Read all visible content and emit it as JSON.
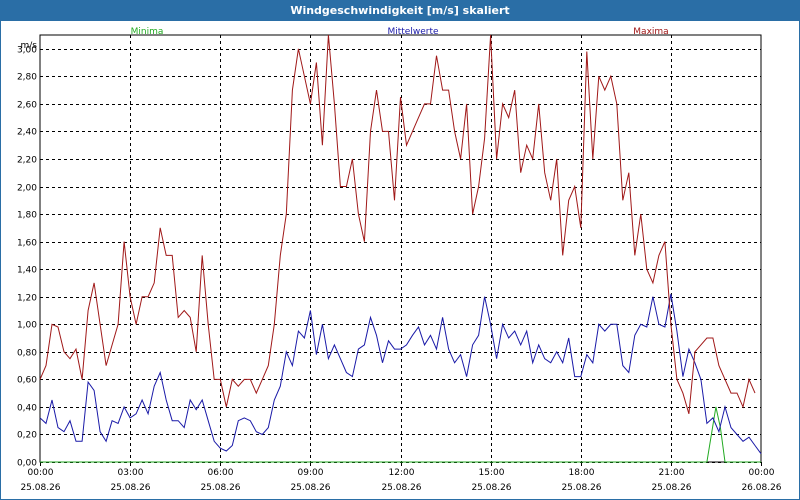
{
  "window": {
    "title": "Windgeschwindigkeit [m/s] skaliert"
  },
  "colors": {
    "min": "#22aa22",
    "avg": "#1a1aa8",
    "max": "#a01818",
    "grid": "#000000",
    "titlebar": "#2a6ea6"
  },
  "chart_data": {
    "type": "line",
    "title": "Windgeschwindigkeit [m/s] skaliert",
    "unit_label": "m/s",
    "ylim": [
      0,
      3.1
    ],
    "yticks": [
      "0,00",
      "0,20",
      "0,40",
      "0,60",
      "0,80",
      "1,00",
      "1,20",
      "1,40",
      "1,60",
      "1,80",
      "2,00",
      "2,20",
      "2,40",
      "2,60",
      "2,80",
      "3,00"
    ],
    "xlim_hours": [
      0,
      24
    ],
    "xticks": [
      {
        "time": "00:00",
        "date": "25.08.26"
      },
      {
        "time": "03:00",
        "date": "25.08.26"
      },
      {
        "time": "06:00",
        "date": "25.08.26"
      },
      {
        "time": "09:00",
        "date": "25.08.26"
      },
      {
        "time": "12:00",
        "date": "25.08.26"
      },
      {
        "time": "15:00",
        "date": "25.08.26"
      },
      {
        "time": "18:00",
        "date": "25.08.26"
      },
      {
        "time": "21:00",
        "date": "25.08.26"
      },
      {
        "time": "00:00",
        "date": "26.08.26"
      }
    ],
    "grid": true,
    "legend_position": "top",
    "series": [
      {
        "name": "Minima",
        "color": "#22aa22",
        "points": [
          [
            0,
            0
          ],
          [
            22.2,
            0
          ],
          [
            22.35,
            0.2
          ],
          [
            22.5,
            0.4
          ],
          [
            22.65,
            0.25
          ],
          [
            22.8,
            0
          ],
          [
            24,
            0
          ]
        ]
      },
      {
        "name": "Mittelwerte",
        "color": "#1a1aa8",
        "points": [
          [
            0,
            0.32
          ],
          [
            0.2,
            0.28
          ],
          [
            0.4,
            0.45
          ],
          [
            0.6,
            0.25
          ],
          [
            0.8,
            0.22
          ],
          [
            1.0,
            0.3
          ],
          [
            1.2,
            0.15
          ],
          [
            1.4,
            0.15
          ],
          [
            1.6,
            0.58
          ],
          [
            1.8,
            0.52
          ],
          [
            2.0,
            0.22
          ],
          [
            2.2,
            0.15
          ],
          [
            2.4,
            0.3
          ],
          [
            2.6,
            0.28
          ],
          [
            2.8,
            0.4
          ],
          [
            3.0,
            0.32
          ],
          [
            3.2,
            0.35
          ],
          [
            3.4,
            0.45
          ],
          [
            3.6,
            0.35
          ],
          [
            3.8,
            0.55
          ],
          [
            4.0,
            0.65
          ],
          [
            4.2,
            0.45
          ],
          [
            4.4,
            0.3
          ],
          [
            4.6,
            0.3
          ],
          [
            4.8,
            0.25
          ],
          [
            5.0,
            0.45
          ],
          [
            5.2,
            0.38
          ],
          [
            5.4,
            0.45
          ],
          [
            5.6,
            0.3
          ],
          [
            5.8,
            0.15
          ],
          [
            6.0,
            0.1
          ],
          [
            6.2,
            0.08
          ],
          [
            6.4,
            0.12
          ],
          [
            6.6,
            0.3
          ],
          [
            6.8,
            0.32
          ],
          [
            7.0,
            0.3
          ],
          [
            7.2,
            0.22
          ],
          [
            7.4,
            0.2
          ],
          [
            7.6,
            0.25
          ],
          [
            7.8,
            0.45
          ],
          [
            8.0,
            0.55
          ],
          [
            8.2,
            0.8
          ],
          [
            8.4,
            0.7
          ],
          [
            8.6,
            0.95
          ],
          [
            8.8,
            0.9
          ],
          [
            9.0,
            1.1
          ],
          [
            9.2,
            0.78
          ],
          [
            9.4,
            1.0
          ],
          [
            9.6,
            0.75
          ],
          [
            9.8,
            0.85
          ],
          [
            10.0,
            0.75
          ],
          [
            10.2,
            0.65
          ],
          [
            10.4,
            0.62
          ],
          [
            10.6,
            0.82
          ],
          [
            10.8,
            0.85
          ],
          [
            11.0,
            1.05
          ],
          [
            11.2,
            0.92
          ],
          [
            11.4,
            0.72
          ],
          [
            11.6,
            0.88
          ],
          [
            11.8,
            0.82
          ],
          [
            12.0,
            0.82
          ],
          [
            12.2,
            0.85
          ],
          [
            12.4,
            0.92
          ],
          [
            12.6,
            0.98
          ],
          [
            12.8,
            0.85
          ],
          [
            13.0,
            0.92
          ],
          [
            13.2,
            0.82
          ],
          [
            13.4,
            1.05
          ],
          [
            13.6,
            0.82
          ],
          [
            13.8,
            0.72
          ],
          [
            14.0,
            0.78
          ],
          [
            14.2,
            0.62
          ],
          [
            14.4,
            0.85
          ],
          [
            14.6,
            0.92
          ],
          [
            14.8,
            1.2
          ],
          [
            15.0,
            1.0
          ],
          [
            15.2,
            0.75
          ],
          [
            15.4,
            1.0
          ],
          [
            15.6,
            0.9
          ],
          [
            15.8,
            0.95
          ],
          [
            16.0,
            0.85
          ],
          [
            16.2,
            0.95
          ],
          [
            16.4,
            0.72
          ],
          [
            16.6,
            0.85
          ],
          [
            16.8,
            0.75
          ],
          [
            17.0,
            0.72
          ],
          [
            17.2,
            0.8
          ],
          [
            17.4,
            0.72
          ],
          [
            17.6,
            0.9
          ],
          [
            17.8,
            0.62
          ],
          [
            18.0,
            0.62
          ],
          [
            18.2,
            0.78
          ],
          [
            18.4,
            0.72
          ],
          [
            18.6,
            1.0
          ],
          [
            18.8,
            0.95
          ],
          [
            19.0,
            1.0
          ],
          [
            19.2,
            1.0
          ],
          [
            19.4,
            0.7
          ],
          [
            19.6,
            0.65
          ],
          [
            19.8,
            0.92
          ],
          [
            20.0,
            1.0
          ],
          [
            20.2,
            0.98
          ],
          [
            20.4,
            1.2
          ],
          [
            20.6,
            1.0
          ],
          [
            20.8,
            0.98
          ],
          [
            21.0,
            1.22
          ],
          [
            21.2,
            0.95
          ],
          [
            21.4,
            0.62
          ],
          [
            21.6,
            0.82
          ],
          [
            21.8,
            0.72
          ],
          [
            22.0,
            0.6
          ],
          [
            22.2,
            0.28
          ],
          [
            22.4,
            0.32
          ],
          [
            22.6,
            0.22
          ],
          [
            22.8,
            0.4
          ],
          [
            23.0,
            0.25
          ],
          [
            23.2,
            0.2
          ],
          [
            23.4,
            0.15
          ],
          [
            23.6,
            0.18
          ],
          [
            23.8,
            0.12
          ],
          [
            24.0,
            0.06
          ]
        ]
      },
      {
        "name": "Maxima",
        "color": "#a01818",
        "points": [
          [
            0,
            0.6
          ],
          [
            0.2,
            0.7
          ],
          [
            0.4,
            1.0
          ],
          [
            0.6,
            0.98
          ],
          [
            0.8,
            0.8
          ],
          [
            1.0,
            0.75
          ],
          [
            1.2,
            0.82
          ],
          [
            1.4,
            0.6
          ],
          [
            1.6,
            1.1
          ],
          [
            1.8,
            1.3
          ],
          [
            2.0,
            1.0
          ],
          [
            2.2,
            0.7
          ],
          [
            2.4,
            0.85
          ],
          [
            2.6,
            1.0
          ],
          [
            2.8,
            1.6
          ],
          [
            3.0,
            1.2
          ],
          [
            3.2,
            1.0
          ],
          [
            3.4,
            1.2
          ],
          [
            3.6,
            1.2
          ],
          [
            3.8,
            1.3
          ],
          [
            4.0,
            1.7
          ],
          [
            4.2,
            1.5
          ],
          [
            4.4,
            1.5
          ],
          [
            4.6,
            1.05
          ],
          [
            4.8,
            1.1
          ],
          [
            5.0,
            1.05
          ],
          [
            5.2,
            0.8
          ],
          [
            5.4,
            1.5
          ],
          [
            5.6,
            1.0
          ],
          [
            5.8,
            0.6
          ],
          [
            6.0,
            0.6
          ],
          [
            6.2,
            0.4
          ],
          [
            6.4,
            0.6
          ],
          [
            6.6,
            0.55
          ],
          [
            6.8,
            0.6
          ],
          [
            7.0,
            0.6
          ],
          [
            7.2,
            0.5
          ],
          [
            7.4,
            0.6
          ],
          [
            7.6,
            0.7
          ],
          [
            7.8,
            1.0
          ],
          [
            8.0,
            1.5
          ],
          [
            8.2,
            1.8
          ],
          [
            8.4,
            2.7
          ],
          [
            8.6,
            3.0
          ],
          [
            8.8,
            2.8
          ],
          [
            9.0,
            2.6
          ],
          [
            9.2,
            2.9
          ],
          [
            9.4,
            2.3
          ],
          [
            9.6,
            3.1
          ],
          [
            9.8,
            2.6
          ],
          [
            10.0,
            2.0
          ],
          [
            10.2,
            2.0
          ],
          [
            10.4,
            2.2
          ],
          [
            10.6,
            1.8
          ],
          [
            10.8,
            1.6
          ],
          [
            11.0,
            2.4
          ],
          [
            11.2,
            2.7
          ],
          [
            11.4,
            2.4
          ],
          [
            11.6,
            2.4
          ],
          [
            11.8,
            1.9
          ],
          [
            12.0,
            2.65
          ],
          [
            12.2,
            2.3
          ],
          [
            12.4,
            2.4
          ],
          [
            12.6,
            2.5
          ],
          [
            12.8,
            2.6
          ],
          [
            13.0,
            2.6
          ],
          [
            13.2,
            2.95
          ],
          [
            13.4,
            2.7
          ],
          [
            13.6,
            2.7
          ],
          [
            13.8,
            2.4
          ],
          [
            14.0,
            2.2
          ],
          [
            14.2,
            2.6
          ],
          [
            14.4,
            1.8
          ],
          [
            14.6,
            2.0
          ],
          [
            14.8,
            2.35
          ],
          [
            15.0,
            3.1
          ],
          [
            15.2,
            2.2
          ],
          [
            15.4,
            2.6
          ],
          [
            15.6,
            2.5
          ],
          [
            15.8,
            2.7
          ],
          [
            16.0,
            2.1
          ],
          [
            16.2,
            2.3
          ],
          [
            16.4,
            2.2
          ],
          [
            16.6,
            2.6
          ],
          [
            16.8,
            2.1
          ],
          [
            17.0,
            1.9
          ],
          [
            17.2,
            2.2
          ],
          [
            17.4,
            1.5
          ],
          [
            17.6,
            1.9
          ],
          [
            17.8,
            2.0
          ],
          [
            18.0,
            1.7
          ],
          [
            18.2,
            2.98
          ],
          [
            18.4,
            2.2
          ],
          [
            18.6,
            2.8
          ],
          [
            18.8,
            2.7
          ],
          [
            19.0,
            2.8
          ],
          [
            19.2,
            2.6
          ],
          [
            19.4,
            1.9
          ],
          [
            19.6,
            2.1
          ],
          [
            19.8,
            1.5
          ],
          [
            20.0,
            1.8
          ],
          [
            20.2,
            1.4
          ],
          [
            20.4,
            1.3
          ],
          [
            20.6,
            1.5
          ],
          [
            20.8,
            1.6
          ],
          [
            21.0,
            1.0
          ],
          [
            21.2,
            0.6
          ],
          [
            21.4,
            0.5
          ],
          [
            21.6,
            0.35
          ],
          [
            21.8,
            0.8
          ],
          [
            22.0,
            0.85
          ],
          [
            22.2,
            0.9
          ],
          [
            22.4,
            0.9
          ],
          [
            22.6,
            0.7
          ],
          [
            22.8,
            0.6
          ],
          [
            23.0,
            0.5
          ],
          [
            23.2,
            0.5
          ],
          [
            23.4,
            0.4
          ],
          [
            23.6,
            0.6
          ],
          [
            23.8,
            0.5
          ]
        ]
      }
    ]
  }
}
